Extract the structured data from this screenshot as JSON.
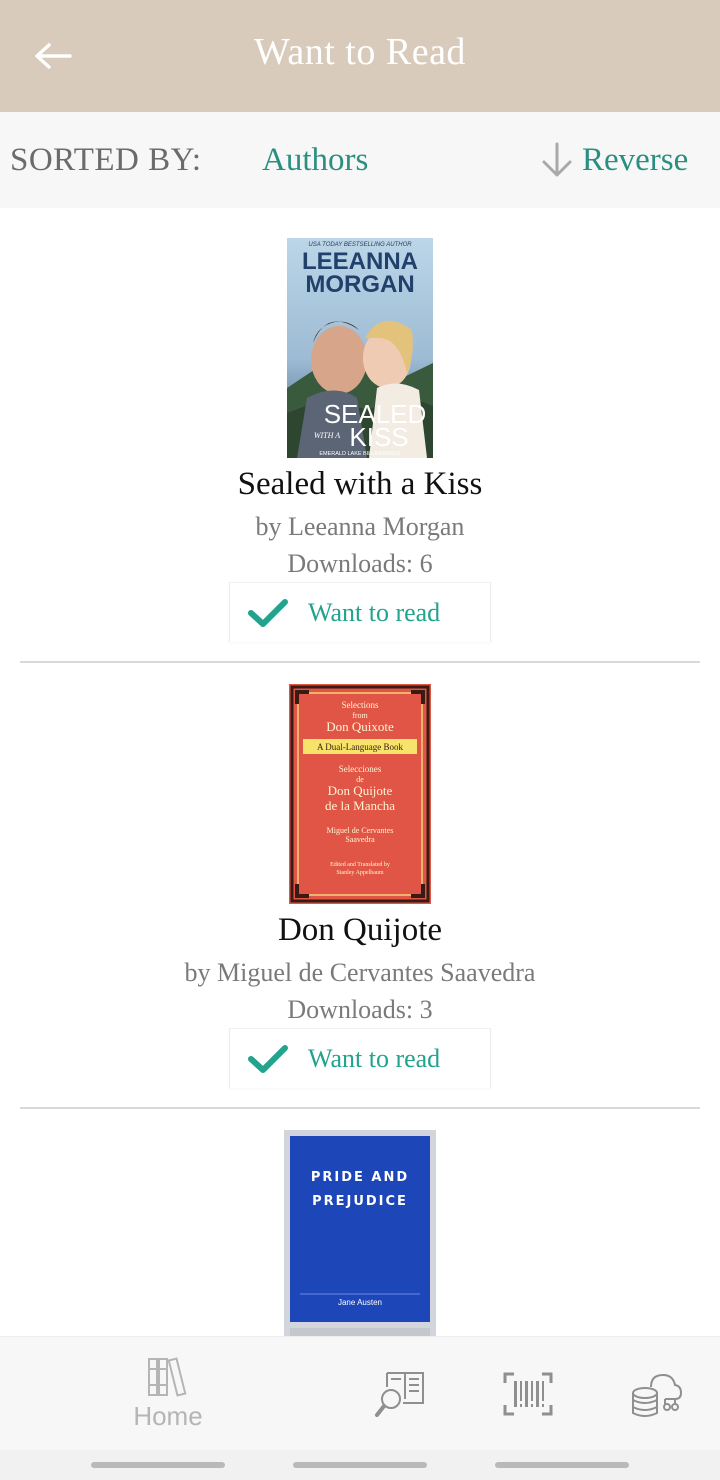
{
  "header": {
    "title": "Want to Read",
    "back_icon": "arrow-left-icon",
    "bg_color": "#d8cbbb"
  },
  "sort_bar": {
    "label": "SORTED BY:",
    "value": "Authors",
    "reverse_label": "Reverse",
    "reverse_icon": "arrow-down-icon",
    "accent_color": "#2a8f80"
  },
  "books": [
    {
      "title": "Sealed with a Kiss",
      "author": "by Leeanna Morgan",
      "downloads": "Downloads: 6",
      "want_label": "Want to read",
      "cover": {
        "top_text": "USA TODAY BESTSELLING AUTHOR",
        "author_line1": "LEEANNA",
        "author_line2": "MORGAN",
        "title_line1": "SEALED",
        "title_small": "WITH A",
        "title_line2": "KISS",
        "series": "EMERALD LAKE BILLIONAIRES"
      }
    },
    {
      "title": "Don Quijote",
      "author": "by Miguel de Cervantes Saavedra",
      "downloads": "Downloads: 3",
      "want_label": "Want to read",
      "cover": {
        "line1": "Selections",
        "line2": "from",
        "line3": "Don Quixote",
        "banner": "A Dual-Language Book",
        "line4": "Selecciones",
        "line5": "de",
        "line6": "Don Quijote",
        "line7": "de la Mancha",
        "line8": "Miguel de Cervantes",
        "line9": "Saavedra",
        "line10": "Edited and Translated by",
        "line11": "Stanley Appelbaum"
      }
    },
    {
      "title": "",
      "author": "",
      "downloads": "",
      "cover": {
        "title_line1": "PRIDE AND",
        "title_line2": "PREJUDICE",
        "author": "Jane Austen"
      }
    }
  ],
  "bottom_nav": {
    "home_label": "Home",
    "home_icon": "bookshelf-icon",
    "search_icon": "book-search-icon",
    "scan_icon": "barcode-scan-icon",
    "sync_icon": "cloud-database-icon"
  }
}
